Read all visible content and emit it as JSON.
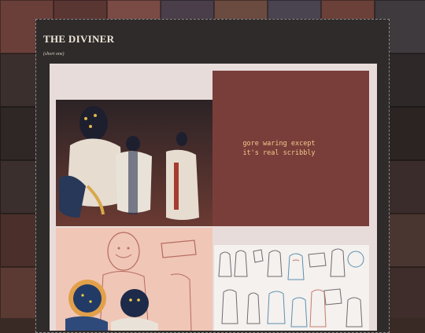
{
  "post": {
    "title": "THE DIVINER",
    "subtitle": "(short one)"
  },
  "gallery": {
    "caption": "gore waring except\nit's real scribbly"
  },
  "colors": {
    "page_background": "#3a2a26",
    "post_background": "#2e2b2a",
    "gallery_background": "#e8dcda",
    "caption_box": "#7a3e3a",
    "caption_text": "#f1c98c",
    "title_text": "#efe6da"
  }
}
